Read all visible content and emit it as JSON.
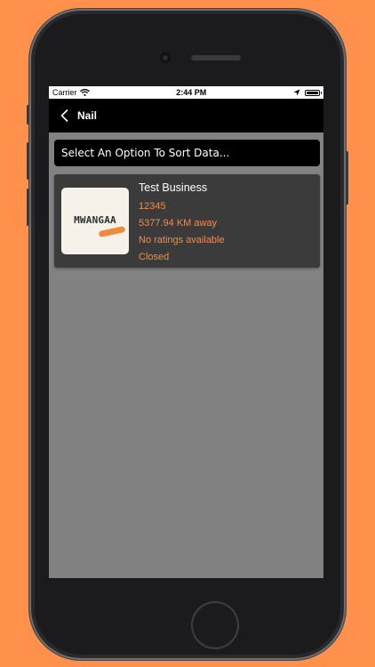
{
  "status_bar": {
    "carrier": "Carrier",
    "time": "2:44 PM",
    "battery_level": 1.0
  },
  "nav": {
    "title": "Nail",
    "back_icon": "chevron-left-icon"
  },
  "sort": {
    "label": "Select An Option To Sort Data..."
  },
  "listings": [
    {
      "logo_text": "MWANGAA",
      "name": "Test Business",
      "phone": "12345",
      "distance": "5377.94 KM away",
      "rating": "No ratings available",
      "status": "Closed"
    }
  ],
  "colors": {
    "background": "#ff914d",
    "accent_text": "#f58b4e",
    "card": "#3b3b3b",
    "screen": "#828282"
  }
}
